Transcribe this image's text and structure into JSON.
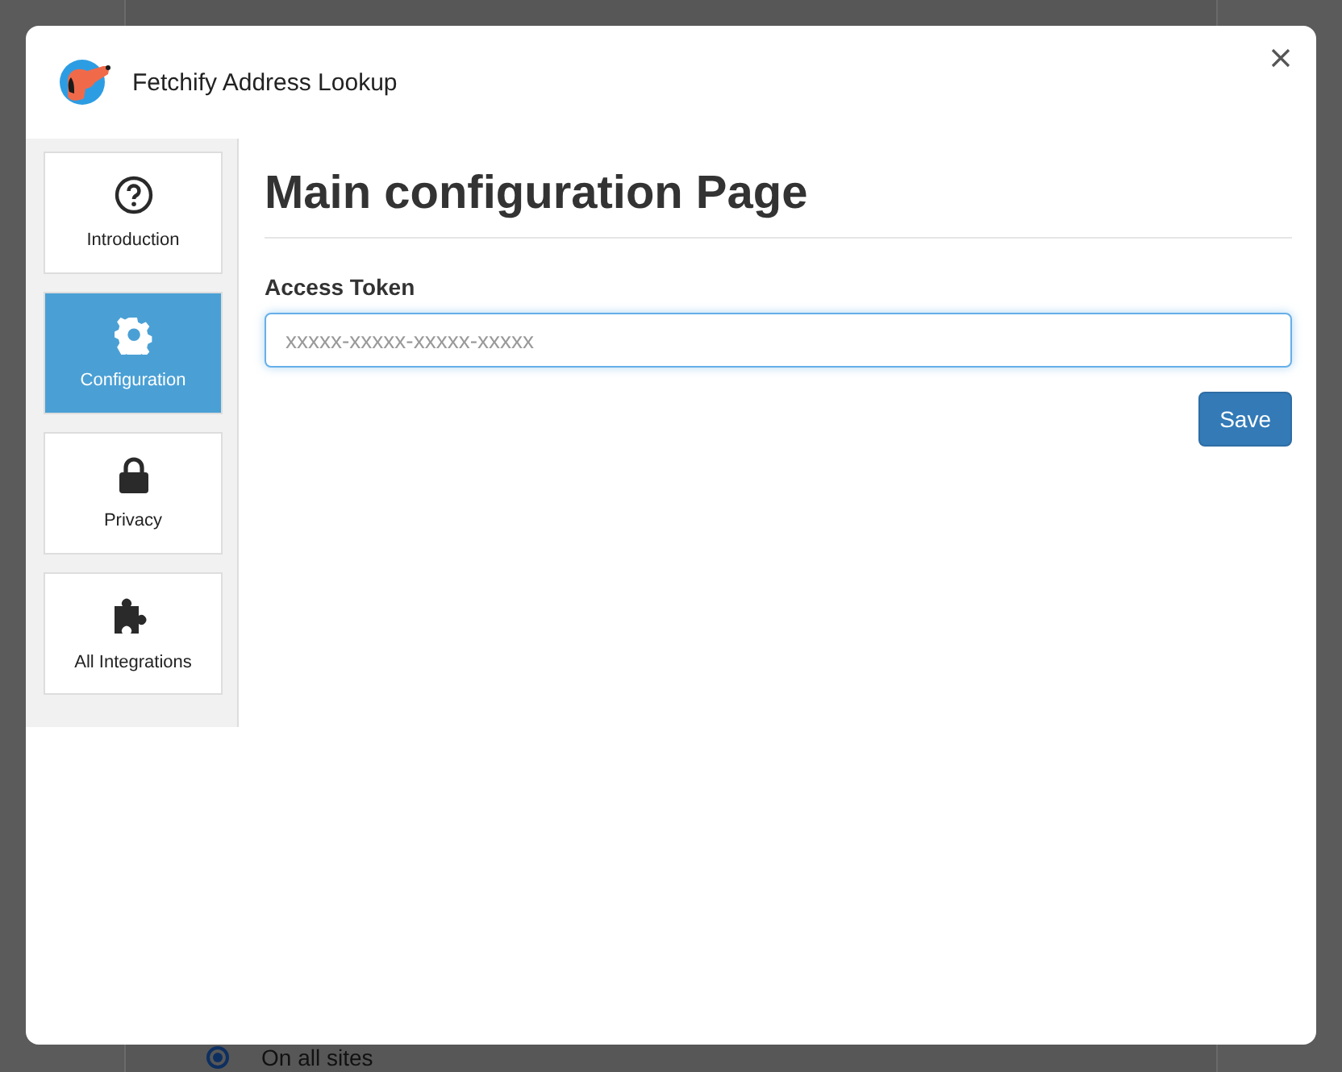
{
  "dialog": {
    "title": "Fetchify Address Lookup"
  },
  "nav": [
    {
      "kind": "help",
      "label": "Introduction",
      "selected": false
    },
    {
      "kind": "gear",
      "label": "Configuration",
      "selected": true
    },
    {
      "kind": "lock",
      "label": "Privacy",
      "selected": false
    },
    {
      "kind": "puzzle",
      "label": "All Integrations",
      "selected": false
    }
  ],
  "page": {
    "heading": "Main configuration Page",
    "field_label": "Access Token",
    "placeholder": "xxxxx-xxxxx-xxxxx-xxxxx",
    "save": "Save"
  },
  "background": {
    "radio": {
      "label": "On all sites",
      "selected": true
    }
  }
}
